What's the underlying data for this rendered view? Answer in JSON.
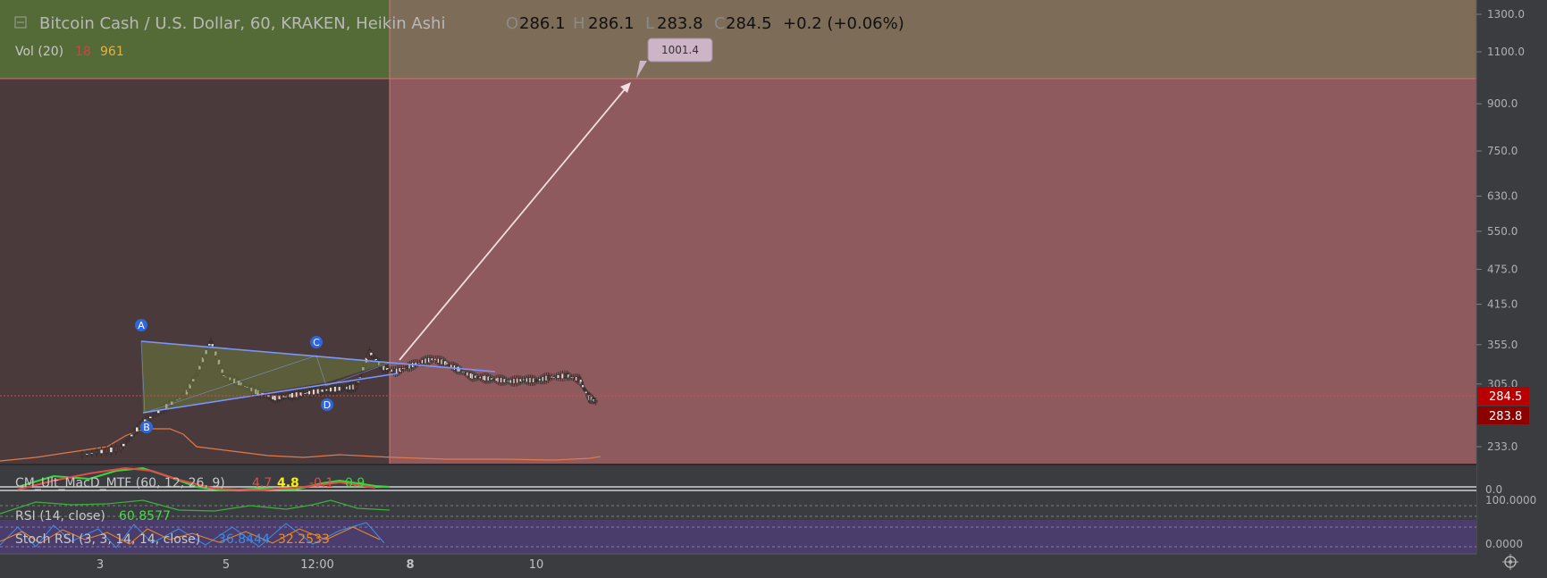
{
  "header": {
    "symbol_title": "Bitcoin Cash / U.S. Dollar, 60, KRAKEN, Heikin Ashi",
    "o_label": "O",
    "o_value": "286.1",
    "h_label": "H",
    "h_value": "286.1",
    "l_label": "L",
    "l_value": "283.8",
    "c_label": "C",
    "c_value": "284.5",
    "change": "+0.2 (+0.06%)"
  },
  "vol": {
    "label": "Vol (20)",
    "v1": "18",
    "v2": "961"
  },
  "target_label": "1001.4",
  "pattern_points": [
    "A",
    "B",
    "C",
    "D"
  ],
  "price_axis": {
    "ticks": [
      "1300.0",
      "1100.0",
      "900.0",
      "750.0",
      "630.0",
      "550.0",
      "475.0",
      "415.0",
      "355.0",
      "305.0",
      "233.0"
    ],
    "last_price": "284.5",
    "low_price": "283.8"
  },
  "indicators": {
    "macd": {
      "label": "CM_Ult_MacD_MTF (60, 12, 26, 9)",
      "v1": "4.7",
      "v2": "4.8",
      "v3": "-0.1",
      "v4": "0.9",
      "axis": "0.0"
    },
    "rsi": {
      "label": "RSI (14, close)",
      "value": "60.8577",
      "axis": "100.0000"
    },
    "stoch": {
      "label": "Stoch RSI (3, 3, 14, 14, close)",
      "k": "36.8444",
      "d": "32.2533",
      "axis": "0.0000"
    }
  },
  "time_axis": [
    "3",
    "5",
    "12:00",
    "8",
    "10"
  ],
  "colors": {
    "background": "#3a3c40",
    "green_zone": "#556b37",
    "red_zone": "#8e5a5e",
    "upper_band": "#7d6c58",
    "dark_left": "#4a3a3c",
    "triangle": "#7b96ff",
    "last_price_tag": "#b80000",
    "vol_v1": "#c24a4a",
    "vol_v2": "#e3b341",
    "macd_v1": "#e34a4a",
    "macd_v2": "#f4f000",
    "stoch_k": "#3b8eea",
    "stoch_d": "#f08a24",
    "rsi_value": "#4cd84c"
  },
  "chart_data": {
    "type": "candlestick",
    "title": "Bitcoin Cash / U.S. Dollar, 60, KRAKEN, Heikin Ashi",
    "y_scale": "log",
    "y_ticks": [
      233,
      305,
      355,
      415,
      475,
      550,
      630,
      750,
      900,
      1100,
      1300
    ],
    "x_ticks": [
      "3",
      "5",
      "12:00",
      "8",
      "10"
    ],
    "last_close": 284.5,
    "ohlc_last": {
      "open": 286.1,
      "high": 286.1,
      "low": 283.8,
      "close": 284.5
    },
    "change": 0.2,
    "change_pct": 0.06,
    "projection_target": 1001.4,
    "price_path": [
      [
        0.0,
        232
      ],
      [
        0.9,
        238
      ],
      [
        1.4,
        262
      ],
      [
        1.9,
        278
      ],
      [
        2.4,
        292
      ],
      [
        2.7,
        320
      ],
      [
        3.0,
        360
      ],
      [
        3.3,
        315
      ],
      [
        3.7,
        305
      ],
      [
        4.1,
        295
      ],
      [
        4.5,
        289
      ],
      [
        4.9,
        292
      ],
      [
        5.3,
        295
      ],
      [
        5.7,
        298
      ],
      [
        6.1,
        300
      ],
      [
        6.4,
        302
      ],
      [
        6.7,
        345
      ],
      [
        7.0,
        325
      ],
      [
        7.3,
        320
      ],
      [
        7.6,
        326
      ],
      [
        7.9,
        332
      ],
      [
        8.2,
        336
      ],
      [
        8.5,
        330
      ],
      [
        8.8,
        322
      ],
      [
        9.1,
        314
      ],
      [
        9.4,
        312
      ],
      [
        9.7,
        310
      ],
      [
        10.0,
        308
      ],
      [
        10.3,
        310
      ],
      [
        10.6,
        309
      ],
      [
        10.9,
        313
      ],
      [
        11.3,
        315
      ],
      [
        11.6,
        310
      ],
      [
        11.8,
        290
      ],
      [
        12.0,
        284.5
      ]
    ],
    "pattern": {
      "A": 355,
      "B": 262,
      "C": 340,
      "D": 296
    }
  }
}
